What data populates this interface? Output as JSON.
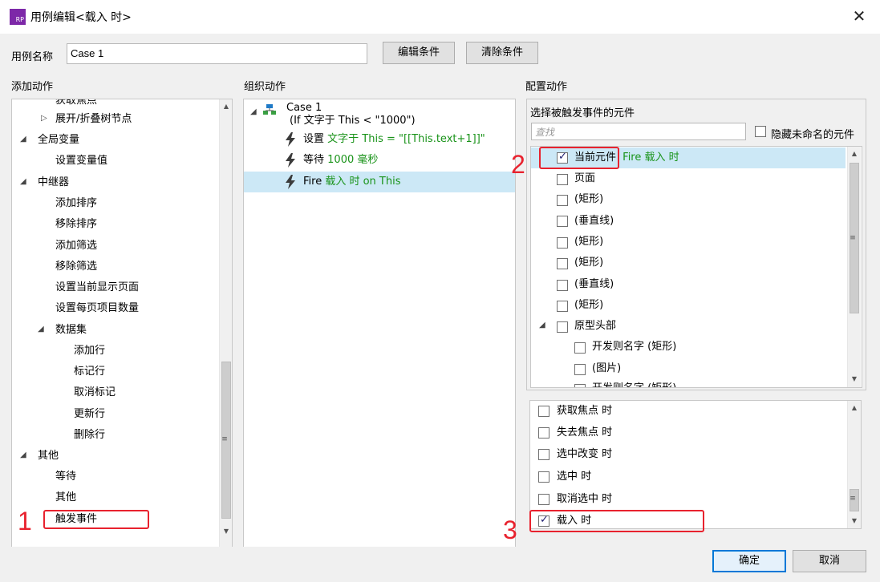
{
  "window": {
    "title": "用例编辑<载入 时>",
    "close_label": "✕"
  },
  "case_name": {
    "label": "用例名称",
    "value": "Case 1"
  },
  "buttons": {
    "edit_condition": "编辑条件",
    "clear_condition": "清除条件",
    "ok": "确定",
    "cancel": "取消"
  },
  "add_actions": {
    "header": "添加动作",
    "items": [
      {
        "label": "获取焦点",
        "indent": 2
      },
      {
        "label": "展开/折叠树节点",
        "indent": 2,
        "collapsed": true
      },
      {
        "label": "全局变量",
        "indent": 1,
        "expanded": true
      },
      {
        "label": "设置变量值",
        "indent": 2
      },
      {
        "label": "中继器",
        "indent": 1,
        "expanded": true
      },
      {
        "label": "添加排序",
        "indent": 2
      },
      {
        "label": "移除排序",
        "indent": 2
      },
      {
        "label": "添加筛选",
        "indent": 2
      },
      {
        "label": "移除筛选",
        "indent": 2
      },
      {
        "label": "设置当前显示页面",
        "indent": 2
      },
      {
        "label": "设置每页项目数量",
        "indent": 2
      },
      {
        "label": "数据集",
        "indent": 2,
        "expanded": true
      },
      {
        "label": "添加行",
        "indent": 3
      },
      {
        "label": "标记行",
        "indent": 3
      },
      {
        "label": "取消标记",
        "indent": 3
      },
      {
        "label": "更新行",
        "indent": 3
      },
      {
        "label": "删除行",
        "indent": 3
      },
      {
        "label": "其他",
        "indent": 1,
        "expanded": true
      },
      {
        "label": "等待",
        "indent": 2
      },
      {
        "label": "其他",
        "indent": 2
      },
      {
        "label": "触发事件",
        "indent": 2
      }
    ]
  },
  "organize_actions": {
    "header": "组织动作",
    "case_title": "Case 1",
    "case_condition": "(If 文字于 This < \"1000\")",
    "actions": [
      {
        "verb": "设置",
        "detail": "文字于 This = \"[[This.text+1]]\""
      },
      {
        "verb": "等待",
        "detail": "1000 毫秒"
      },
      {
        "verb": "Fire",
        "detail": "载入 时 on This"
      }
    ]
  },
  "configure_actions": {
    "header": "配置动作",
    "select_label": "选择被触发事件的元件",
    "search_placeholder": "查找",
    "hide_unnamed": "隐藏未命名的元件",
    "widgets": [
      {
        "label": "当前元件",
        "extra": "Fire 载入 时",
        "checked": true
      },
      {
        "label": "页面",
        "checked": false
      },
      {
        "label": "(矩形)",
        "checked": false
      },
      {
        "label": "(垂直线)",
        "checked": false
      },
      {
        "label": "(矩形)",
        "checked": false
      },
      {
        "label": "(矩形)",
        "checked": false
      },
      {
        "label": "(垂直线)",
        "checked": false
      },
      {
        "label": "(矩形)",
        "checked": false
      },
      {
        "label": "原型头部",
        "checked": false
      },
      {
        "label": "开发则名字 (矩形)",
        "checked": false
      },
      {
        "label": "(图片)",
        "checked": false
      },
      {
        "label": "开发则名字 (矩形)",
        "checked": false
      }
    ],
    "events": [
      {
        "label": "获取焦点 时",
        "checked": false
      },
      {
        "label": "失去焦点 时",
        "checked": false
      },
      {
        "label": "选中改变 时",
        "checked": false
      },
      {
        "label": "选中 时",
        "checked": false
      },
      {
        "label": "取消选中 时",
        "checked": false
      },
      {
        "label": "载入 时",
        "checked": true
      }
    ]
  },
  "annotations": {
    "step1": "1",
    "step2": "2",
    "step3": "3"
  },
  "colors": {
    "accent_green": "#199319",
    "selection": "#cce8f6",
    "annotation_red": "#e8222e",
    "app_icon": "#7d28a8"
  }
}
